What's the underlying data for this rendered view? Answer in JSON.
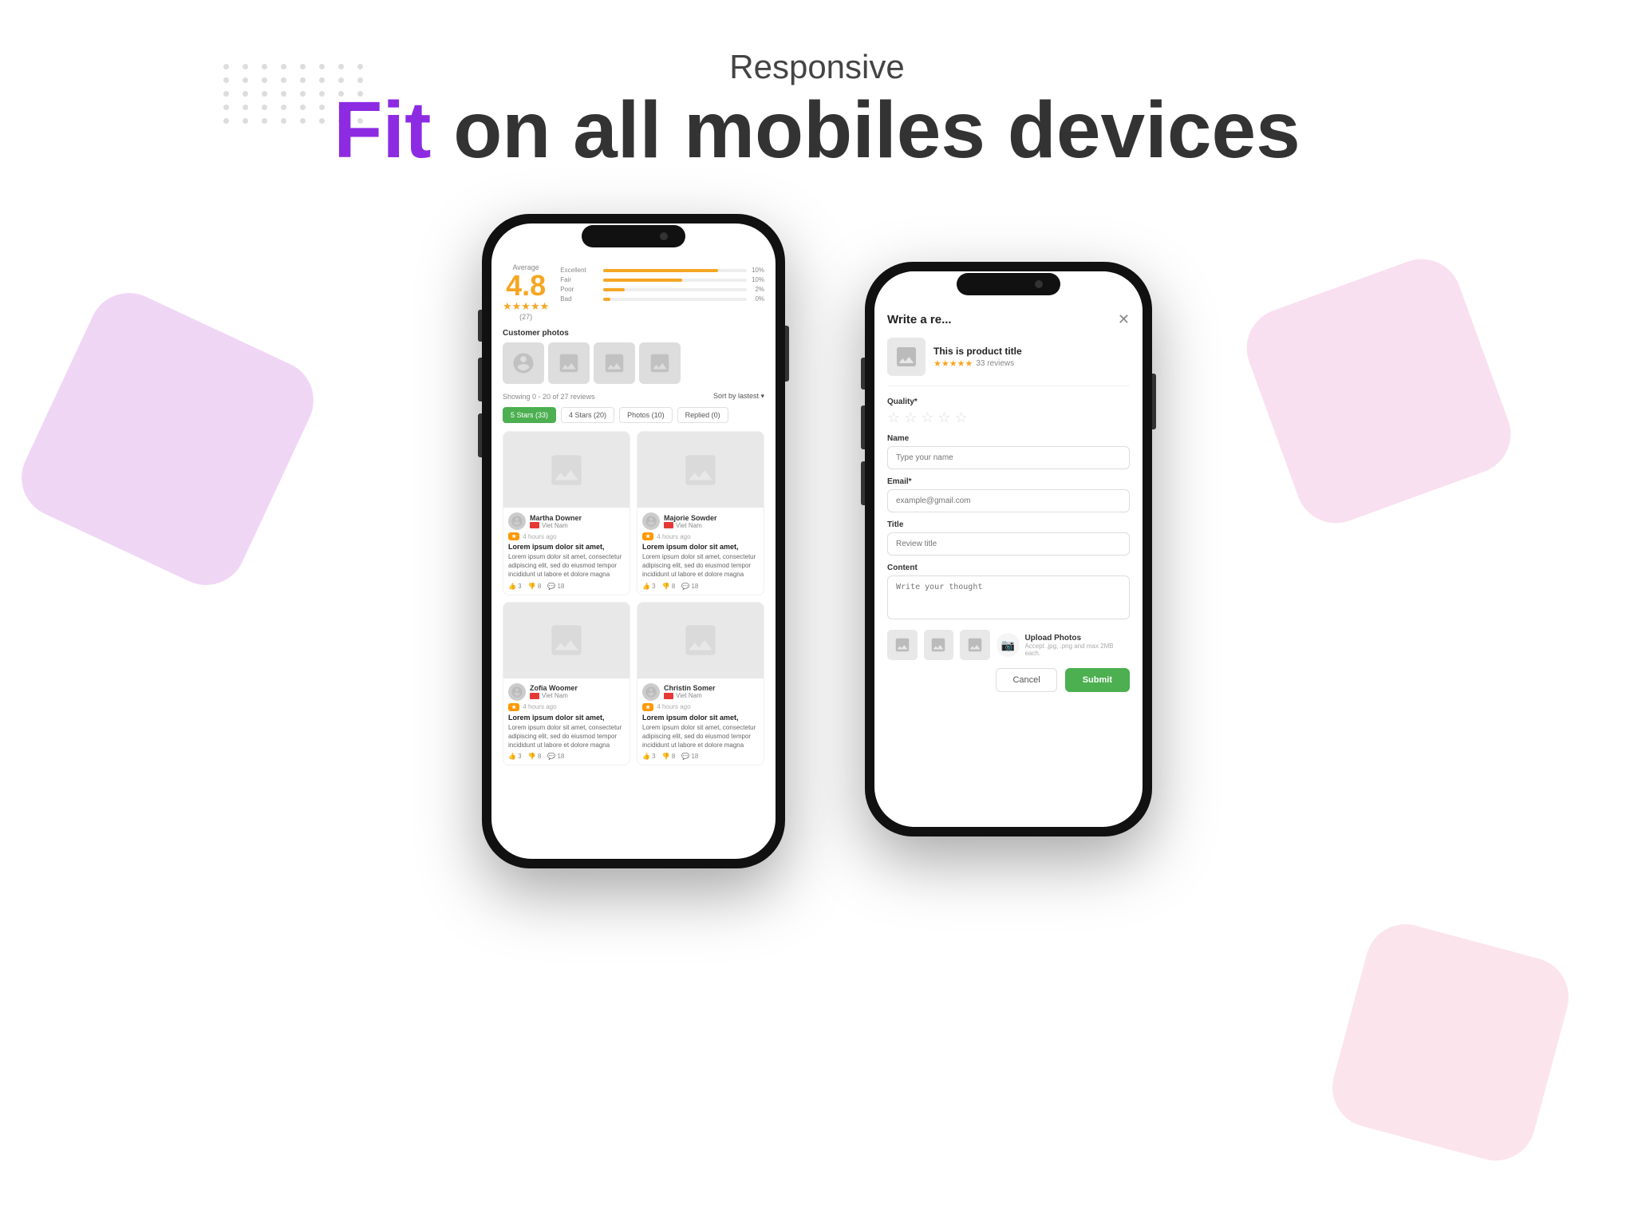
{
  "header": {
    "responsive_label": "Responsive",
    "headline_fit": "Fit",
    "headline_rest": " on all mobiles devices"
  },
  "left_phone": {
    "average_label": "Average",
    "average_value": "4.8",
    "average_stars": "★★★★★",
    "average_count": "(27)",
    "bars": [
      {
        "label": "Excellent",
        "pct_text": "10%",
        "width": 80
      },
      {
        "label": "Fair",
        "pct_text": "10%",
        "width": 55
      },
      {
        "label": "Poor",
        "pct_text": "2%",
        "width": 15
      },
      {
        "label": "Bad",
        "pct_text": "0%",
        "width": 5
      }
    ],
    "customer_photos_label": "Customer photos",
    "showing_text": "Showing 0 - 20 of 27 reviews",
    "sort_label": "Sort by lastest ▾",
    "filters": [
      {
        "label": "5 Stars (33)",
        "active": true
      },
      {
        "label": "4 Stars (20)",
        "active": false
      },
      {
        "label": "Photos (10)",
        "active": false
      },
      {
        "label": "Replied (0)",
        "active": false
      }
    ],
    "reviews": [
      {
        "name": "Martha Downer",
        "country": "Viet Nam",
        "star": "★",
        "time": "4 hours ago",
        "title": "Lorem ipsum dolor sit amet,",
        "text": "Lorem ipsum dolor sit amet, consectetur adipiscing elit, sed do eiusmod tempor incididunt ut labore et dolore magna",
        "likes": "3",
        "dislikes": "8",
        "comments": "18"
      },
      {
        "name": "Majorie Sowder",
        "country": "Viet Nam",
        "star": "★",
        "time": "4 hours ago",
        "title": "Lorem ipsum dolor sit amet,",
        "text": "Lorem ipsum dolor sit amet, consectetur adipiscing elit, sed do eiusmod tempor incididunt ut labore et dolore magna",
        "likes": "3",
        "dislikes": "8",
        "comments": "18"
      },
      {
        "name": "Zofia Woomer",
        "country": "Viet Nam",
        "star": "★",
        "time": "4 hours ago",
        "title": "Lorem ipsum dolor sit amet,",
        "text": "Lorem ipsum dolor sit amet, consectetur adipiscing elit, sed do eiusmod tempor incididunt ut labore et dolore magna",
        "likes": "3",
        "dislikes": "8",
        "comments": "18"
      },
      {
        "name": "Christin Somer",
        "country": "Viet Nam",
        "star": "★",
        "time": "4 hours ago",
        "title": "Lorem ipsum dolor sit amet,",
        "text": "Lorem ipsum dolor sit amet, consectetur adipiscing elit, sed do eiusmod tempor incididunt ut labore et dolore magna",
        "likes": "3",
        "dislikes": "8",
        "comments": "18"
      }
    ]
  },
  "right_phone": {
    "modal_title": "Write a re...",
    "close_label": "✕",
    "product_title": "This is product title",
    "product_stars": "★★★★★",
    "product_review_count": "33 reviews",
    "quality_label": "Quality*",
    "name_label": "Name",
    "name_placeholder": "Type your name",
    "email_label": "Email*",
    "email_placeholder": "example@gmail.com",
    "title_label": "Title",
    "title_placeholder": "Review title",
    "content_label": "Content",
    "content_placeholder": "Write your thought",
    "upload_label": "Upload Photos",
    "upload_hint": "Accept .jpg, .png and max 2MB each.",
    "cancel_label": "Cancel",
    "submit_label": "Submit"
  }
}
